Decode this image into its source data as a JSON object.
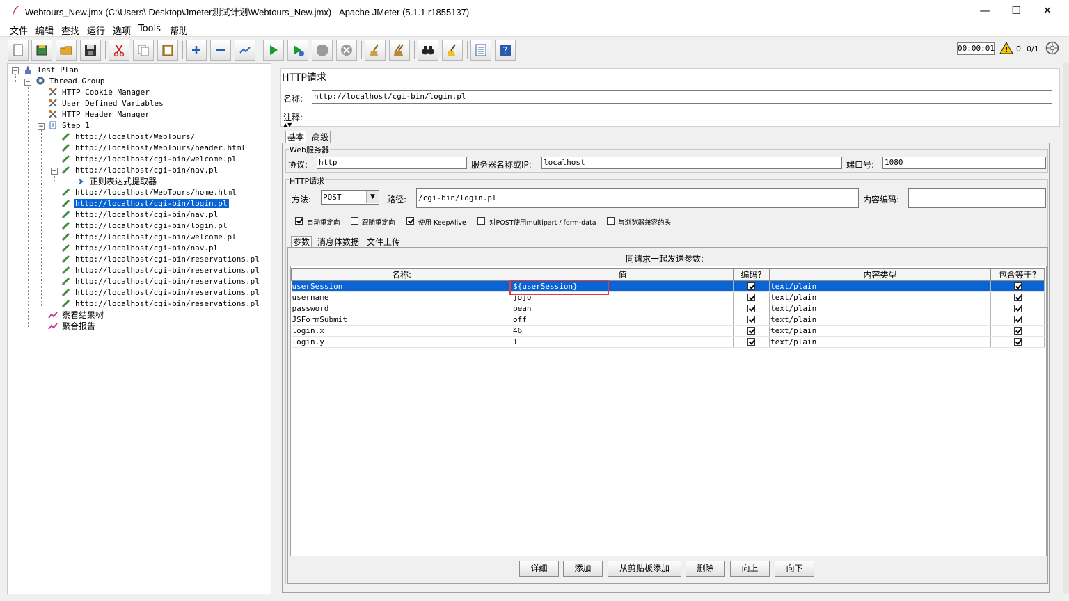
{
  "window": {
    "title": "Webtours_New.jmx (C:\\Users\\        Desktop\\Jmeter测试计划\\Webtours_New.jmx) - Apache JMeter (5.1.1 r1855137)",
    "minimize": "—",
    "maximize": "☐",
    "close": "✕"
  },
  "menu": [
    "文件",
    "编辑",
    "查找",
    "运行",
    "选项",
    "Tools",
    "帮助"
  ],
  "toolbar": {
    "buttons": [
      "new-icon",
      "templates-icon",
      "open-icon",
      "save-icon",
      "cut-icon",
      "copy-icon",
      "paste-icon",
      "expand-icon",
      "collapse-icon",
      "toggle-icon",
      "start-icon",
      "start-no-pause-icon",
      "stop-icon",
      "shutdown-icon",
      "clear-icon",
      "clear-all-icon",
      "search-icon",
      "reset-search-icon",
      "function-helper-icon",
      "help-icon"
    ],
    "timer": "00:00:01",
    "warnings": "0",
    "threads": "0/1"
  },
  "tree": {
    "test_plan": "Test Plan",
    "thread_group": "Thread Group",
    "cookie_manager": "HTTP Cookie Manager",
    "user_vars": "User Defined Variables",
    "header_manager": "HTTP Header Manager",
    "step": "Step 1",
    "samplers": [
      "http://localhost/WebTours/",
      "http://localhost/WebTours/header.html",
      "http://localhost/cgi-bin/welcome.pl",
      "http://localhost/cgi-bin/nav.pl"
    ],
    "extractor": "正则表达式提取器",
    "samplers2": [
      "http://localhost/WebTours/home.html",
      "http://localhost/cgi-bin/login.pl",
      "http://localhost/cgi-bin/nav.pl",
      "http://localhost/cgi-bin/login.pl",
      "http://localhost/cgi-bin/welcome.pl",
      "http://localhost/cgi-bin/nav.pl",
      "http://localhost/cgi-bin/reservations.pl",
      "http://localhost/cgi-bin/reservations.pl",
      "http://localhost/cgi-bin/reservations.pl",
      "http://localhost/cgi-bin/reservations.pl",
      "http://localhost/cgi-bin/reservations.pl"
    ],
    "listener1": "察看结果树",
    "listener2": "聚合报告"
  },
  "panel": {
    "title": "HTTP请求",
    "name_label": "名称:",
    "name_value": "http://localhost/cgi-bin/login.pl",
    "comment_label": "注释:",
    "tabs": [
      "基本",
      "高级"
    ],
    "web_server_group": "Web服务器",
    "protocol_label": "协议:",
    "protocol_value": "http",
    "server_label": "服务器名称或IP:",
    "server_value": "localhost",
    "port_label": "端口号:",
    "port_value": "1080",
    "http_group": "HTTP请求",
    "method_label": "方法:",
    "method_value": "POST",
    "path_label": "路径:",
    "path_value": "/cgi-bin/login.pl",
    "encoding_label": "内容编码:",
    "encoding_value": "",
    "options": [
      {
        "label": "自动重定向",
        "checked": true
      },
      {
        "label": "跟随重定向",
        "checked": false
      },
      {
        "label": "使用 KeepAlive",
        "checked": true
      },
      {
        "label": "对POST使用multipart / form-data",
        "checked": false
      },
      {
        "label": "与浏览器兼容的头",
        "checked": false
      }
    ],
    "subtabs": [
      "参数",
      "消息体数据",
      "文件上传"
    ],
    "params_caption": "同请求一起发送参数:",
    "columns": [
      "名称:",
      "值",
      "编码?",
      "内容类型",
      "包含等于?"
    ],
    "rows": [
      {
        "name": "userSession",
        "value": "${userSession}",
        "type": "text/plain"
      },
      {
        "name": "username",
        "value": "jojo",
        "type": "text/plain"
      },
      {
        "name": "password",
        "value": "bean",
        "type": "text/plain"
      },
      {
        "name": "JSFormSubmit",
        "value": "off",
        "type": "text/plain"
      },
      {
        "name": "login.x",
        "value": "46",
        "type": "text/plain"
      },
      {
        "name": "login.y",
        "value": "1",
        "type": "text/plain"
      }
    ],
    "buttons": [
      "详细",
      "添加",
      "从剪贴板添加",
      "删除",
      "向上",
      "向下"
    ]
  }
}
